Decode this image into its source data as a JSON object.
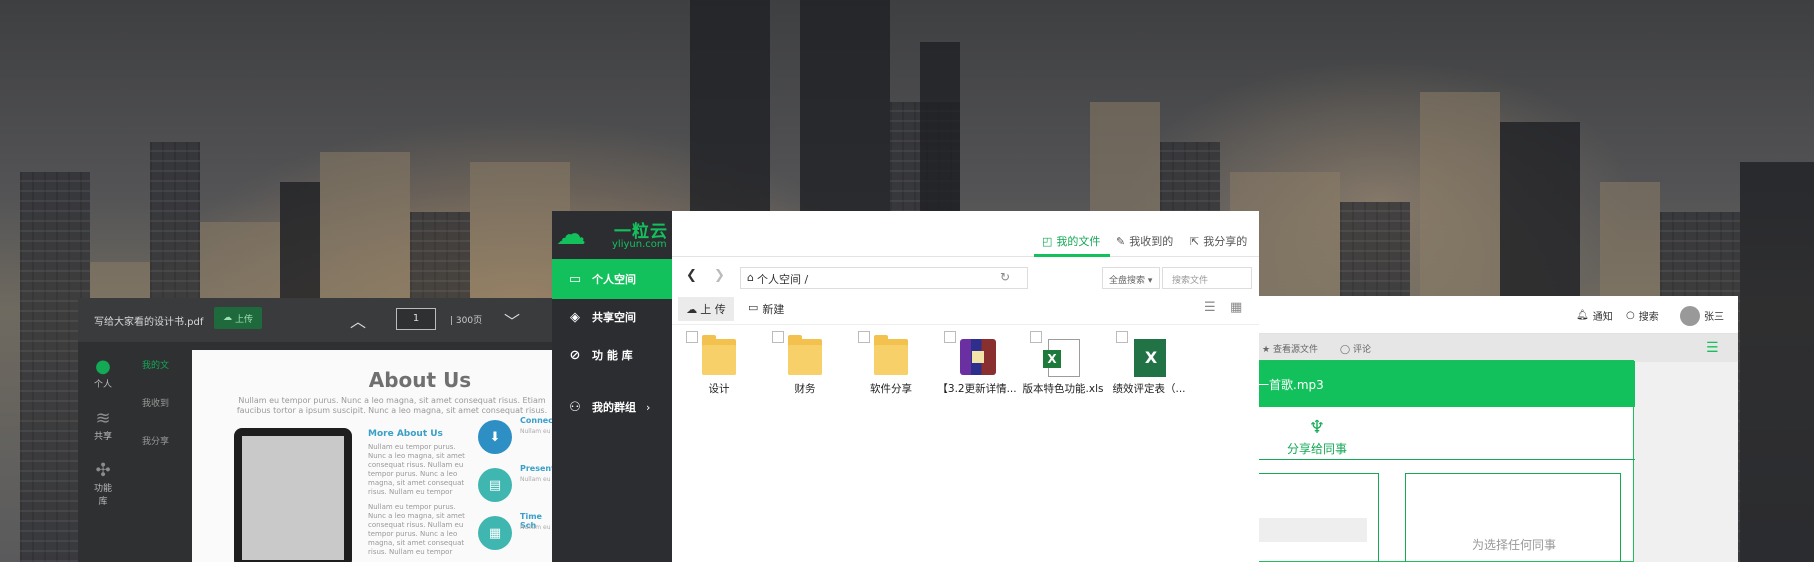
{
  "pdf_viewer": {
    "file_name": "写给大家看的设计书.pdf",
    "upload_label": "上传",
    "page_value": "1",
    "page_total": "| 300页",
    "side_icons": [
      "个人",
      "共享",
      "功能库"
    ],
    "nav_items": [
      "我的文",
      "我收到",
      "我分享"
    ],
    "doc": {
      "title": "About Us",
      "lede": "Nullam eu tempor purus. Nunc a leo magna, sit amet consequat risus. Etiam faucibus tortor a ipsum suscipit. Nunc a leo magna, sit amet consequat risus.",
      "col_title": "More About Us",
      "col_text_1": "Nullam eu tempor purus. Nunc a leo magna, sit amet consequat risus. Nullam eu tempor purus. Nunc a leo magna, sit amet consequat risus. Nullam eu tempor purus. Nunc a leo magna, sit amet consequat risus.",
      "col_text_2": "Nullam eu tempor purus. Nunc a leo magna, sit amet consequat risus. Nullam eu tempor purus. Nunc a leo magna, sit amet consequat risus. Nullam eu tempor purus.",
      "circle_items": [
        {
          "title": "Connect",
          "text": "Nullam eu a leo magna"
        },
        {
          "title": "Presenta",
          "text": "Nullam eu a leo magna"
        },
        {
          "title": "Time Sch",
          "text": "Nullam eu a leo magna"
        }
      ]
    }
  },
  "share_panel": {
    "notify_label": "通知",
    "search_label": "搜索",
    "user_name": "张三",
    "view_source_label": "查看源文件",
    "comment_label": "评论",
    "dialog_title": "一首歌.mp3",
    "share_to_colleague": "分享给同事",
    "empty_message": "为选择任何同事"
  },
  "main": {
    "brand_name": "一粒云",
    "brand_domain": "yliyun.com",
    "sidebar": [
      {
        "label": "个人空间",
        "icon": "folder-icon"
      },
      {
        "label": "共享空间",
        "icon": "layers-icon"
      },
      {
        "label": "功 能 库",
        "icon": "compass-icon"
      },
      {
        "label": "我的群组",
        "icon": "group-icon"
      }
    ],
    "tabs": [
      "我的文件",
      "我收到的",
      "我分享的"
    ],
    "path": "个人空间 /",
    "search_scope": "全盘搜索",
    "search_placeholder": "搜索文件",
    "upload_label": "上 传",
    "new_label": "新建",
    "files": [
      {
        "name": "设计",
        "type": "folder"
      },
      {
        "name": "财务",
        "type": "folder"
      },
      {
        "name": "软件分享",
        "type": "folder"
      },
      {
        "name": "【3.2更新详情...",
        "type": "rar"
      },
      {
        "name": "版本特色功能.xls",
        "type": "xls"
      },
      {
        "name": "绩效评定表（...",
        "type": "xlsx"
      }
    ]
  },
  "colors": {
    "accent": "#13c15c",
    "sidebar_bg": "#2c2d31",
    "folder": "#f2c14e"
  }
}
